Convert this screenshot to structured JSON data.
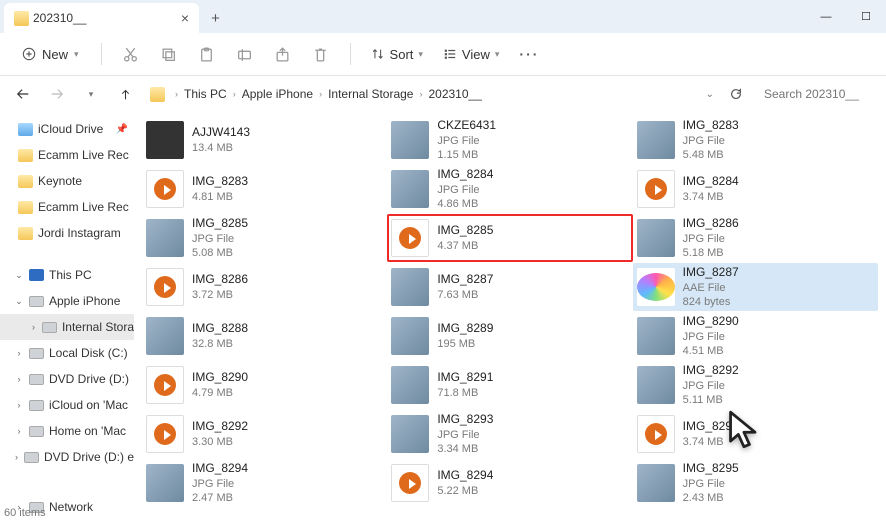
{
  "tab": {
    "title": "202310__"
  },
  "toolbar": {
    "new": "New",
    "sort": "Sort",
    "view": "View"
  },
  "breadcrumb": {
    "items": [
      "This PC",
      "Apple iPhone",
      "Internal Storage",
      "202310__"
    ]
  },
  "search": {
    "placeholder": "Search 202310__"
  },
  "sidebar_top": [
    {
      "label": "iCloud Drive",
      "icon": "blue",
      "pinned": true
    },
    {
      "label": "Ecamm Live Rec",
      "icon": "yellow"
    },
    {
      "label": "Keynote",
      "icon": "yellow"
    },
    {
      "label": "Ecamm Live Rec",
      "icon": "yellow"
    },
    {
      "label": "Jordi Instagram",
      "icon": "yellow"
    }
  ],
  "sidebar_pc": {
    "label": "This PC",
    "device": "Apple iPhone",
    "storage": "Internal Stora",
    "drives": [
      {
        "label": "Local Disk (C:)",
        "icon": "disk"
      },
      {
        "label": "DVD Drive (D:)",
        "icon": "disk"
      },
      {
        "label": "iCloud on 'Mac",
        "icon": "disk"
      },
      {
        "label": "Home on 'Mac",
        "icon": "disk"
      },
      {
        "label": "DVD Drive (D:) e",
        "icon": "disk"
      }
    ],
    "network": "Network"
  },
  "status": {
    "count": "60 items"
  },
  "files": [
    {
      "name": "AJJW4143",
      "type": "",
      "size": "13.4 MB",
      "thumb": "txt"
    },
    {
      "name": "CKZE6431",
      "type": "JPG File",
      "size": "1.15 MB",
      "thumb": "jpg"
    },
    {
      "name": "IMG_8283",
      "type": "JPG File",
      "size": "5.48 MB",
      "thumb": "jpg"
    },
    {
      "name": "IMG_8283",
      "type": "",
      "size": "4.81 MB",
      "thumb": "vid"
    },
    {
      "name": "IMG_8284",
      "type": "JPG File",
      "size": "4.86 MB",
      "thumb": "jpg"
    },
    {
      "name": "IMG_8284",
      "type": "",
      "size": "3.74 MB",
      "thumb": "vid"
    },
    {
      "name": "IMG_8285",
      "type": "JPG File",
      "size": "5.08 MB",
      "thumb": "jpg"
    },
    {
      "name": "IMG_8285",
      "type": "",
      "size": "4.37 MB",
      "thumb": "vid",
      "hl": true
    },
    {
      "name": "IMG_8286",
      "type": "JPG File",
      "size": "5.18 MB",
      "thumb": "jpg"
    },
    {
      "name": "IMG_8286",
      "type": "",
      "size": "3.72 MB",
      "thumb": "vid"
    },
    {
      "name": "IMG_8287",
      "type": "",
      "size": "7.63 MB",
      "thumb": "jpg"
    },
    {
      "name": "IMG_8287",
      "type": "AAE File",
      "size": "824 bytes",
      "thumb": "aae",
      "sel": true
    },
    {
      "name": "IMG_8288",
      "type": "",
      "size": "32.8 MB",
      "thumb": "jpg"
    },
    {
      "name": "IMG_8289",
      "type": "",
      "size": "195 MB",
      "thumb": "jpg"
    },
    {
      "name": "IMG_8290",
      "type": "JPG File",
      "size": "4.51 MB",
      "thumb": "jpg"
    },
    {
      "name": "IMG_8290",
      "type": "",
      "size": "4.79 MB",
      "thumb": "vid"
    },
    {
      "name": "IMG_8291",
      "type": "",
      "size": "71.8 MB",
      "thumb": "jpg"
    },
    {
      "name": "IMG_8292",
      "type": "JPG File",
      "size": "5.11 MB",
      "thumb": "jpg"
    },
    {
      "name": "IMG_8292",
      "type": "",
      "size": "3.30 MB",
      "thumb": "vid"
    },
    {
      "name": "IMG_8293",
      "type": "JPG File",
      "size": "3.34 MB",
      "thumb": "jpg"
    },
    {
      "name": "IMG_8293",
      "type": "",
      "size": "3.74 MB",
      "thumb": "vid"
    },
    {
      "name": "IMG_8294",
      "type": "JPG File",
      "size": "2.47 MB",
      "thumb": "jpg"
    },
    {
      "name": "IMG_8294",
      "type": "",
      "size": "5.22 MB",
      "thumb": "vid"
    },
    {
      "name": "IMG_8295",
      "type": "JPG File",
      "size": "2.43 MB",
      "thumb": "jpg"
    }
  ]
}
